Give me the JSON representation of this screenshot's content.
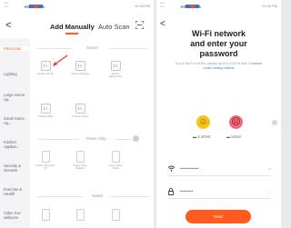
{
  "left": {
    "statusbar": {
      "time": "12:26 PM"
    },
    "header": {
      "back": "<",
      "tab_manual": "Add Manually",
      "tab_auto": "Auto Scan"
    },
    "sidebar": [
      {
        "label": "Electrician",
        "active": true
      },
      {
        "label": "Lighting",
        "active": false
      },
      {
        "label": "Large Home Ap...",
        "active": false
      },
      {
        "label": "Small Home Ap...",
        "active": false
      },
      {
        "label": "Kitchen Applian...",
        "active": false
      },
      {
        "label": "Security & Sensors",
        "active": false
      },
      {
        "label": "Exercise & Health",
        "active": false
      },
      {
        "label": "Video Sur-veillance",
        "active": false
      }
    ],
    "sections": {
      "socket": "Socket",
      "power_strip": "Power Strip",
      "switch": "Switch"
    },
    "socket_devices": [
      "Socket (Wi-Fi)",
      "Socket (Zigbee)",
      "Socket (Bluetooth)",
      "Socket (NB)",
      "Socket (other)"
    ],
    "power_strip_devices": [
      "Power Strip (Wi-Fi)",
      "Power Strip (Zigbee)",
      "Power Strip (other)"
    ]
  },
  "right": {
    "statusbar": {
      "time": "12:26 PM"
    },
    "back": "<",
    "title_line1": "Wi-Fi network",
    "title_line2": "and enter your",
    "title_line3": "password",
    "hint_prefix": "If your Wi-Fi is 5GHz, please set it to 2.4GHz first.",
    "hint_link": "Common router setting method",
    "freq_24": "2.4GHz",
    "freq_5": "5GHz",
    "wifi_name": "•••••••••••••",
    "wifi_tail": "⇄",
    "password_value": "•••••••••",
    "password_tail": "—",
    "next_label": "Next"
  },
  "colors": {
    "accent": "#ff5a1f",
    "link": "#3a7fd6"
  }
}
